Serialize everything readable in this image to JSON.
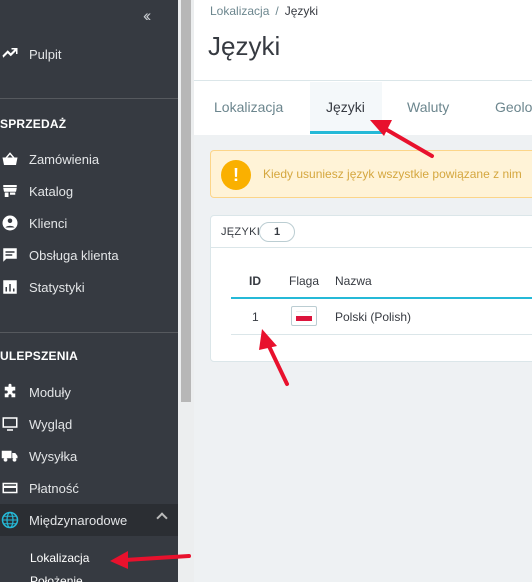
{
  "sidebar": {
    "collapse_icon": "double-chevron-left-icon",
    "top_item": {
      "label": "Pulpit",
      "icon": "trending-up-icon"
    },
    "sections": [
      {
        "title": "SPRZEDAŻ"
      },
      {
        "title": "ULEPSZENIA"
      }
    ],
    "sales_items": [
      {
        "label": "Zamówienia",
        "icon": "basket-icon"
      },
      {
        "label": "Katalog",
        "icon": "store-icon"
      },
      {
        "label": "Klienci",
        "icon": "account-icon"
      },
      {
        "label": "Obsługa klienta",
        "icon": "chat-icon"
      },
      {
        "label": "Statystyki",
        "icon": "bar-chart-icon"
      }
    ],
    "improve_items": [
      {
        "label": "Moduły",
        "icon": "puzzle-icon"
      },
      {
        "label": "Wygląd",
        "icon": "monitor-icon"
      },
      {
        "label": "Wysyłka",
        "icon": "truck-icon"
      },
      {
        "label": "Płatność",
        "icon": "card-icon"
      },
      {
        "label": "Międzynarodowe",
        "icon": "globe-icon",
        "active": true
      }
    ],
    "sub_items": [
      "Lokalizacja",
      "Położenie"
    ]
  },
  "breadcrumb": {
    "parent": "Lokalizacja",
    "separator": "/",
    "current": "Języki"
  },
  "page_title": "Języki",
  "tabs": [
    {
      "label": "Lokalizacja"
    },
    {
      "label": "Języki",
      "active": true
    },
    {
      "label": "Waluty"
    },
    {
      "label": "Geolo"
    }
  ],
  "alert": {
    "text": "Kiedy usuniesz język wszystkie powiązane z nim",
    "icon": "warning-icon"
  },
  "languages_card": {
    "title": "JĘZYKI",
    "count": "1",
    "columns": {
      "id": "ID",
      "flag": "Flaga",
      "name": "Nazwa"
    },
    "rows": [
      {
        "id": "1",
        "flag": "pl-flag-icon",
        "name": "Polski (Polish)"
      }
    ]
  },
  "colors": {
    "accent": "#25b9d7",
    "sidebar": "#363a41",
    "warning": "#fab000",
    "annotation": "#e8112d"
  }
}
